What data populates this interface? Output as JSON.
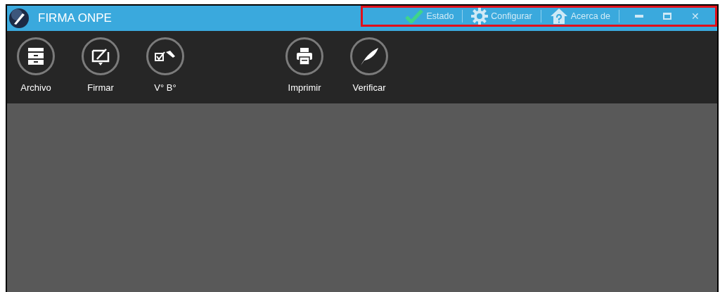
{
  "window": {
    "title": "FIRMA ONPE"
  },
  "title_bar_tools": {
    "highlighted": true,
    "items": [
      {
        "kind": "check",
        "label": "Estado"
      },
      {
        "kind": "gear",
        "label": "Configurar"
      },
      {
        "kind": "house",
        "label": "Acerca de"
      }
    ]
  },
  "window_controls": [
    {
      "kind": "minimize"
    },
    {
      "kind": "maximize"
    },
    {
      "kind": "close",
      "label": "✕"
    }
  ],
  "toolbar": {
    "groups": [
      [
        {
          "kind": "archive",
          "label": "Archivo"
        },
        {
          "kind": "sign",
          "label": "Firmar"
        },
        {
          "kind": "approve",
          "label": "V° B°"
        }
      ],
      [
        {
          "kind": "print",
          "label": "Imprimir"
        },
        {
          "kind": "quill",
          "label": "Verificar"
        }
      ]
    ]
  }
}
